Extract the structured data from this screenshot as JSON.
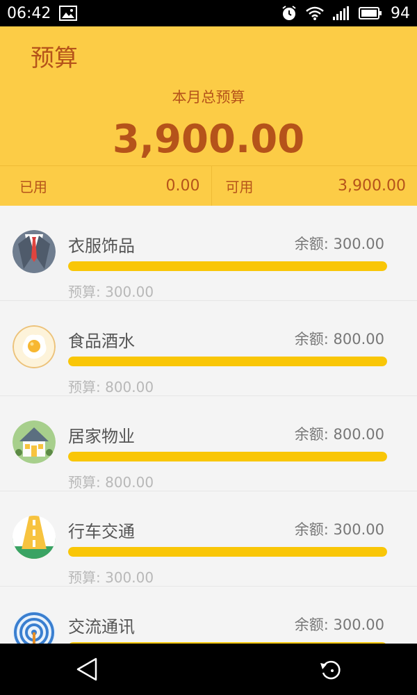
{
  "status_bar": {
    "time": "06:42",
    "battery": "94",
    "icons": [
      "image-icon",
      "alarm-icon",
      "wifi-icon",
      "signal-icon",
      "battery-icon"
    ]
  },
  "header": {
    "title": "预算",
    "total_label": "本月总预算",
    "total_amount": "3,900.00",
    "used_label": "已用",
    "used_value": "0.00",
    "available_label": "可用",
    "available_value": "3,900.00"
  },
  "items": [
    {
      "name": "衣服饰品",
      "balance": "余额: 300.00",
      "budget": "预算: 300.00",
      "progress": 1.0,
      "icon": "suit-icon"
    },
    {
      "name": "食品酒水",
      "balance": "余额: 800.00",
      "budget": "预算: 800.00",
      "progress": 1.0,
      "icon": "egg-icon"
    },
    {
      "name": "居家物业",
      "balance": "余额: 800.00",
      "budget": "预算: 800.00",
      "progress": 1.0,
      "icon": "house-icon"
    },
    {
      "name": "行车交通",
      "balance": "余额: 300.00",
      "budget": "预算: 300.00",
      "progress": 1.0,
      "icon": "road-icon"
    },
    {
      "name": "交流通讯",
      "balance": "余额: 300.00",
      "budget": "",
      "progress": 1.0,
      "icon": "antenna-icon"
    }
  ],
  "nav": {
    "icons": [
      "back-icon",
      "rotate-icon"
    ]
  },
  "colors": {
    "accent": "#fccc46",
    "accent_text": "#b5531a",
    "bar": "#f9c607"
  }
}
